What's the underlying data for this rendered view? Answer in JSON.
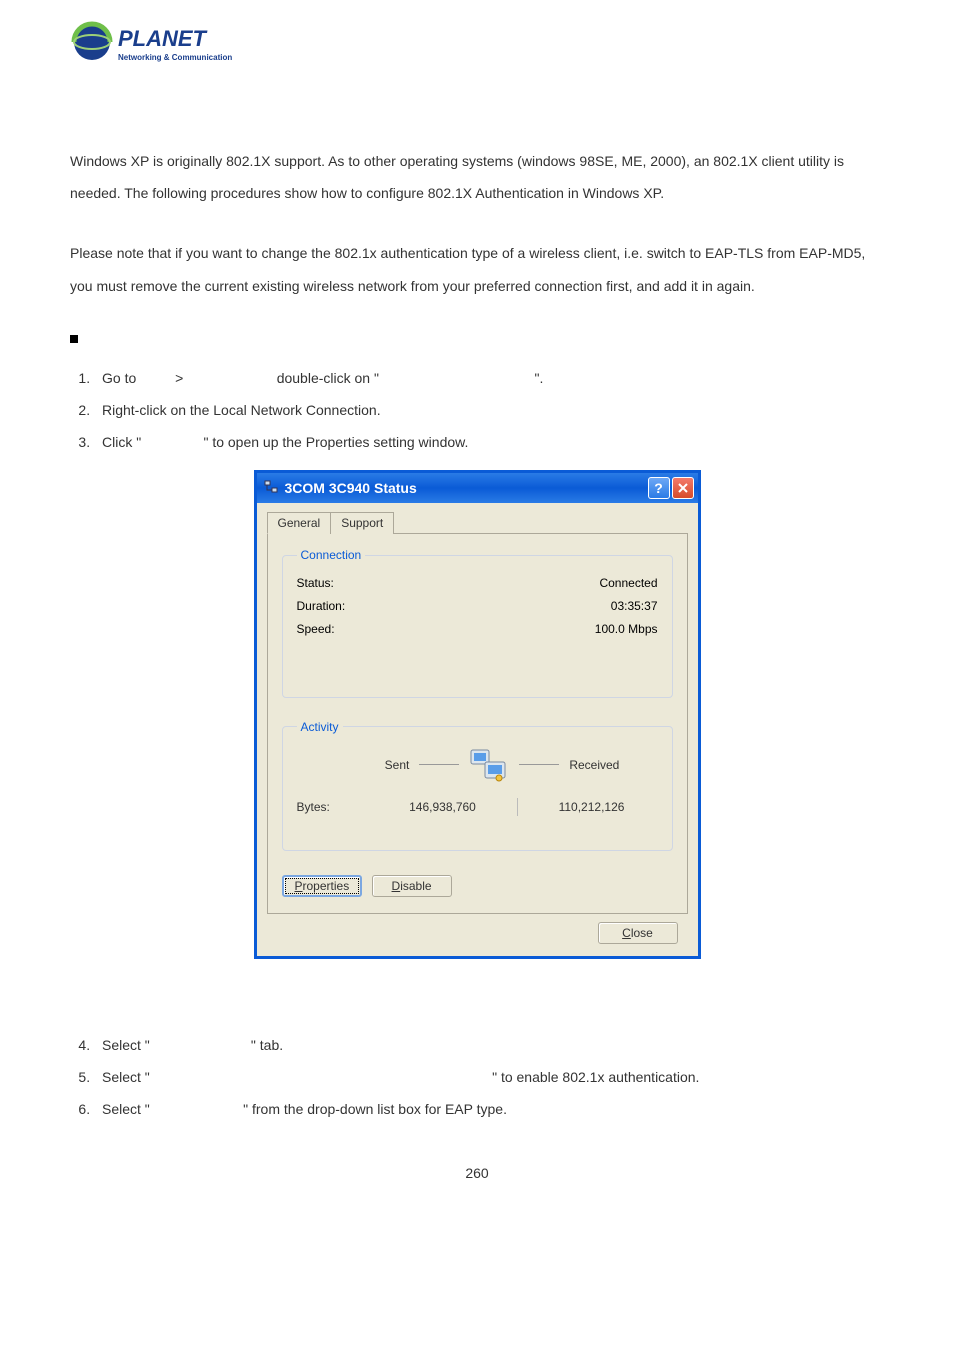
{
  "logo": {
    "brand": "PLANET",
    "tagline": "Networking & Communication"
  },
  "paragraphs": {
    "p1": "Windows XP is originally 802.1X support. As to other operating systems (windows 98SE, ME, 2000), an 802.1X client utility is needed. The following procedures show how to configure 802.1X Authentication in Windows XP.",
    "p2": "Please note that if you want to change the 802.1x authentication type of a wireless client, i.e. switch to EAP-TLS from EAP-MD5, you must remove the current existing wireless network from your preferred connection first, and add it in again."
  },
  "steps_a": {
    "s1_a": "Go to ",
    "s1_b": " > ",
    "s1_c": " double-click on \" ",
    "s1_d": " \".",
    "s2": "Right-click on the Local Network Connection.",
    "s3_a": "Click \" ",
    "s3_b": " \" to open up the Properties setting window."
  },
  "dialog": {
    "title": "3COM 3C940 Status",
    "tabs": {
      "general": "General",
      "support": "Support"
    },
    "connection": {
      "legend": "Connection",
      "status_lbl": "Status:",
      "status_val": "Connected",
      "duration_lbl": "Duration:",
      "duration_val": "03:35:37",
      "speed_lbl": "Speed:",
      "speed_val": "100.0 Mbps"
    },
    "activity": {
      "legend": "Activity",
      "sent": "Sent",
      "received": "Received",
      "bytes_lbl": "Bytes:",
      "bytes_sent": "146,938,760",
      "bytes_recv": "110,212,126"
    },
    "buttons": {
      "properties": "Properties",
      "disable": "Disable",
      "close": "Close"
    }
  },
  "steps_b": {
    "s4_a": "Select \" ",
    "s4_b": " \" tab.",
    "s5_a": "Select \" ",
    "s5_b": " \" to enable 802.1x authentication.",
    "s6_a": "Select \" ",
    "s6_b": " \" from the drop-down list box for EAP type."
  },
  "page_number": "260"
}
